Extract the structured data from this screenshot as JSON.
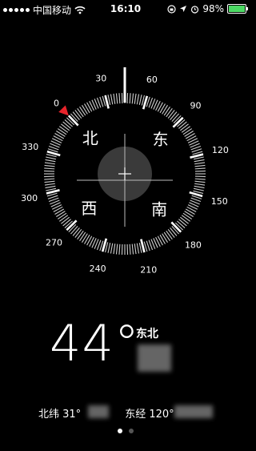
{
  "status_bar": {
    "carrier": "中国移动",
    "time": "16:10",
    "battery_percent": "98%",
    "battery_level": 0.98,
    "icons": [
      "signal-dots-icon",
      "wifi-icon",
      "lock-rotation-icon",
      "location-arrow-icon",
      "alarm-icon",
      "battery-icon"
    ]
  },
  "compass": {
    "degree_labels": [
      "0",
      "30",
      "60",
      "90",
      "120",
      "150",
      "180",
      "210",
      "240",
      "270",
      "300",
      "330"
    ],
    "cardinals": {
      "north": "北",
      "east": "东",
      "south": "南",
      "west": "西"
    },
    "heading_degrees": 44,
    "bearing_marker_degrees": 0
  },
  "readout": {
    "degree_value": "44°",
    "direction": "东北"
  },
  "coordinates": {
    "latitude_label": "北纬 31°",
    "longitude_label": "东经 120°"
  },
  "pager": {
    "pages": 2,
    "active": 0
  },
  "colors": {
    "background": "#000000",
    "foreground": "#ffffff",
    "marker": "#e8242b",
    "battery": "#4cd964"
  }
}
